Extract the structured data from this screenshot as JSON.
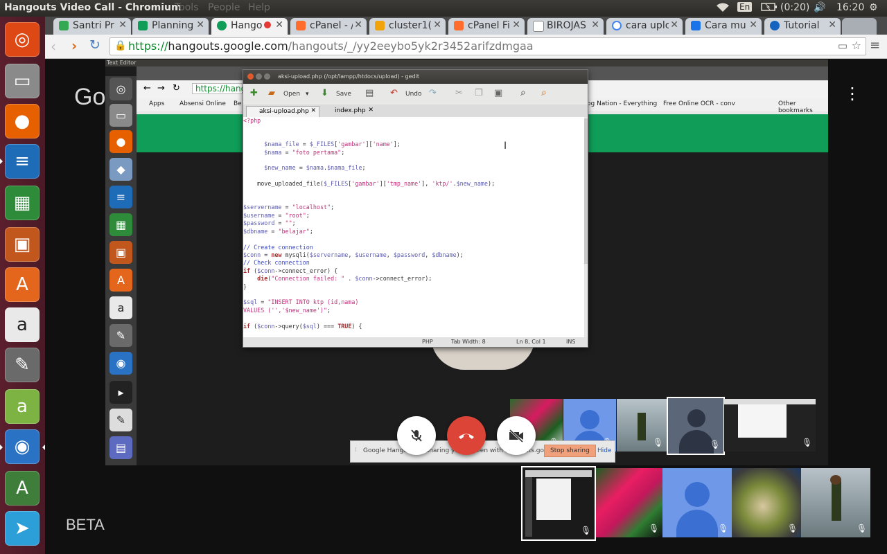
{
  "window": {
    "title": "Hangouts Video Call - Chromium",
    "menus": [
      "Tools",
      "People",
      "Help"
    ]
  },
  "panel": {
    "lang": "En",
    "battery": "(0:20)",
    "time": "16:20"
  },
  "tabs": [
    {
      "label": "Santri Pr",
      "color": "#34a853"
    },
    {
      "label": "Planning",
      "color": "#0f9d58"
    },
    {
      "label": "Hango",
      "color": "#0f9d58"
    },
    {
      "label": "cPanel - /",
      "color": "#ff6c2c"
    },
    {
      "label": "cluster1(",
      "color": "#f0a30a"
    },
    {
      "label": "cPanel Fi",
      "color": "#ff6c2c"
    },
    {
      "label": "BIROJAS",
      "color": "#888888"
    },
    {
      "label": "cara uplc",
      "color": "#4285f4"
    },
    {
      "label": "Cara mu",
      "color": "#1a73e8"
    },
    {
      "label": "Tutorial",
      "color": "#1565c0"
    }
  ],
  "address": {
    "scheme": "https://",
    "host": "hangouts.google.com",
    "path": "/hangouts/_/yy2eeybo5yk2r3452arifzdmgaa"
  },
  "hangout": {
    "logo": "Google",
    "beta": "BETA"
  },
  "inner": {
    "panel_label": "Text Editor",
    "bookmarks": [
      "Apps",
      "Absensi Online",
      "Be",
      "og Nation - Everything",
      "Free Online OCR - conv",
      "Other bookmarks"
    ],
    "url": "https://hang"
  },
  "gedit": {
    "title": "aksi-upload.php (/opt/lampp/htdocs/upload) - gedit",
    "toolbar": {
      "open": "Open",
      "save": "Save",
      "undo": "Undo"
    },
    "tabs": [
      "aksi-upload.php",
      "index.php"
    ],
    "status": {
      "lang": "PHP",
      "tab": "Tab Width: 8",
      "pos": "Ln 8, Col 1",
      "mode": "INS"
    }
  },
  "share": {
    "text": "Google Hangouts is sharing your screen with hangouts.google.com.",
    "stop": "Stop sharing",
    "hide": "Hide"
  },
  "colors": {
    "hangup": "#db4437",
    "accent": "#0f9d58"
  }
}
